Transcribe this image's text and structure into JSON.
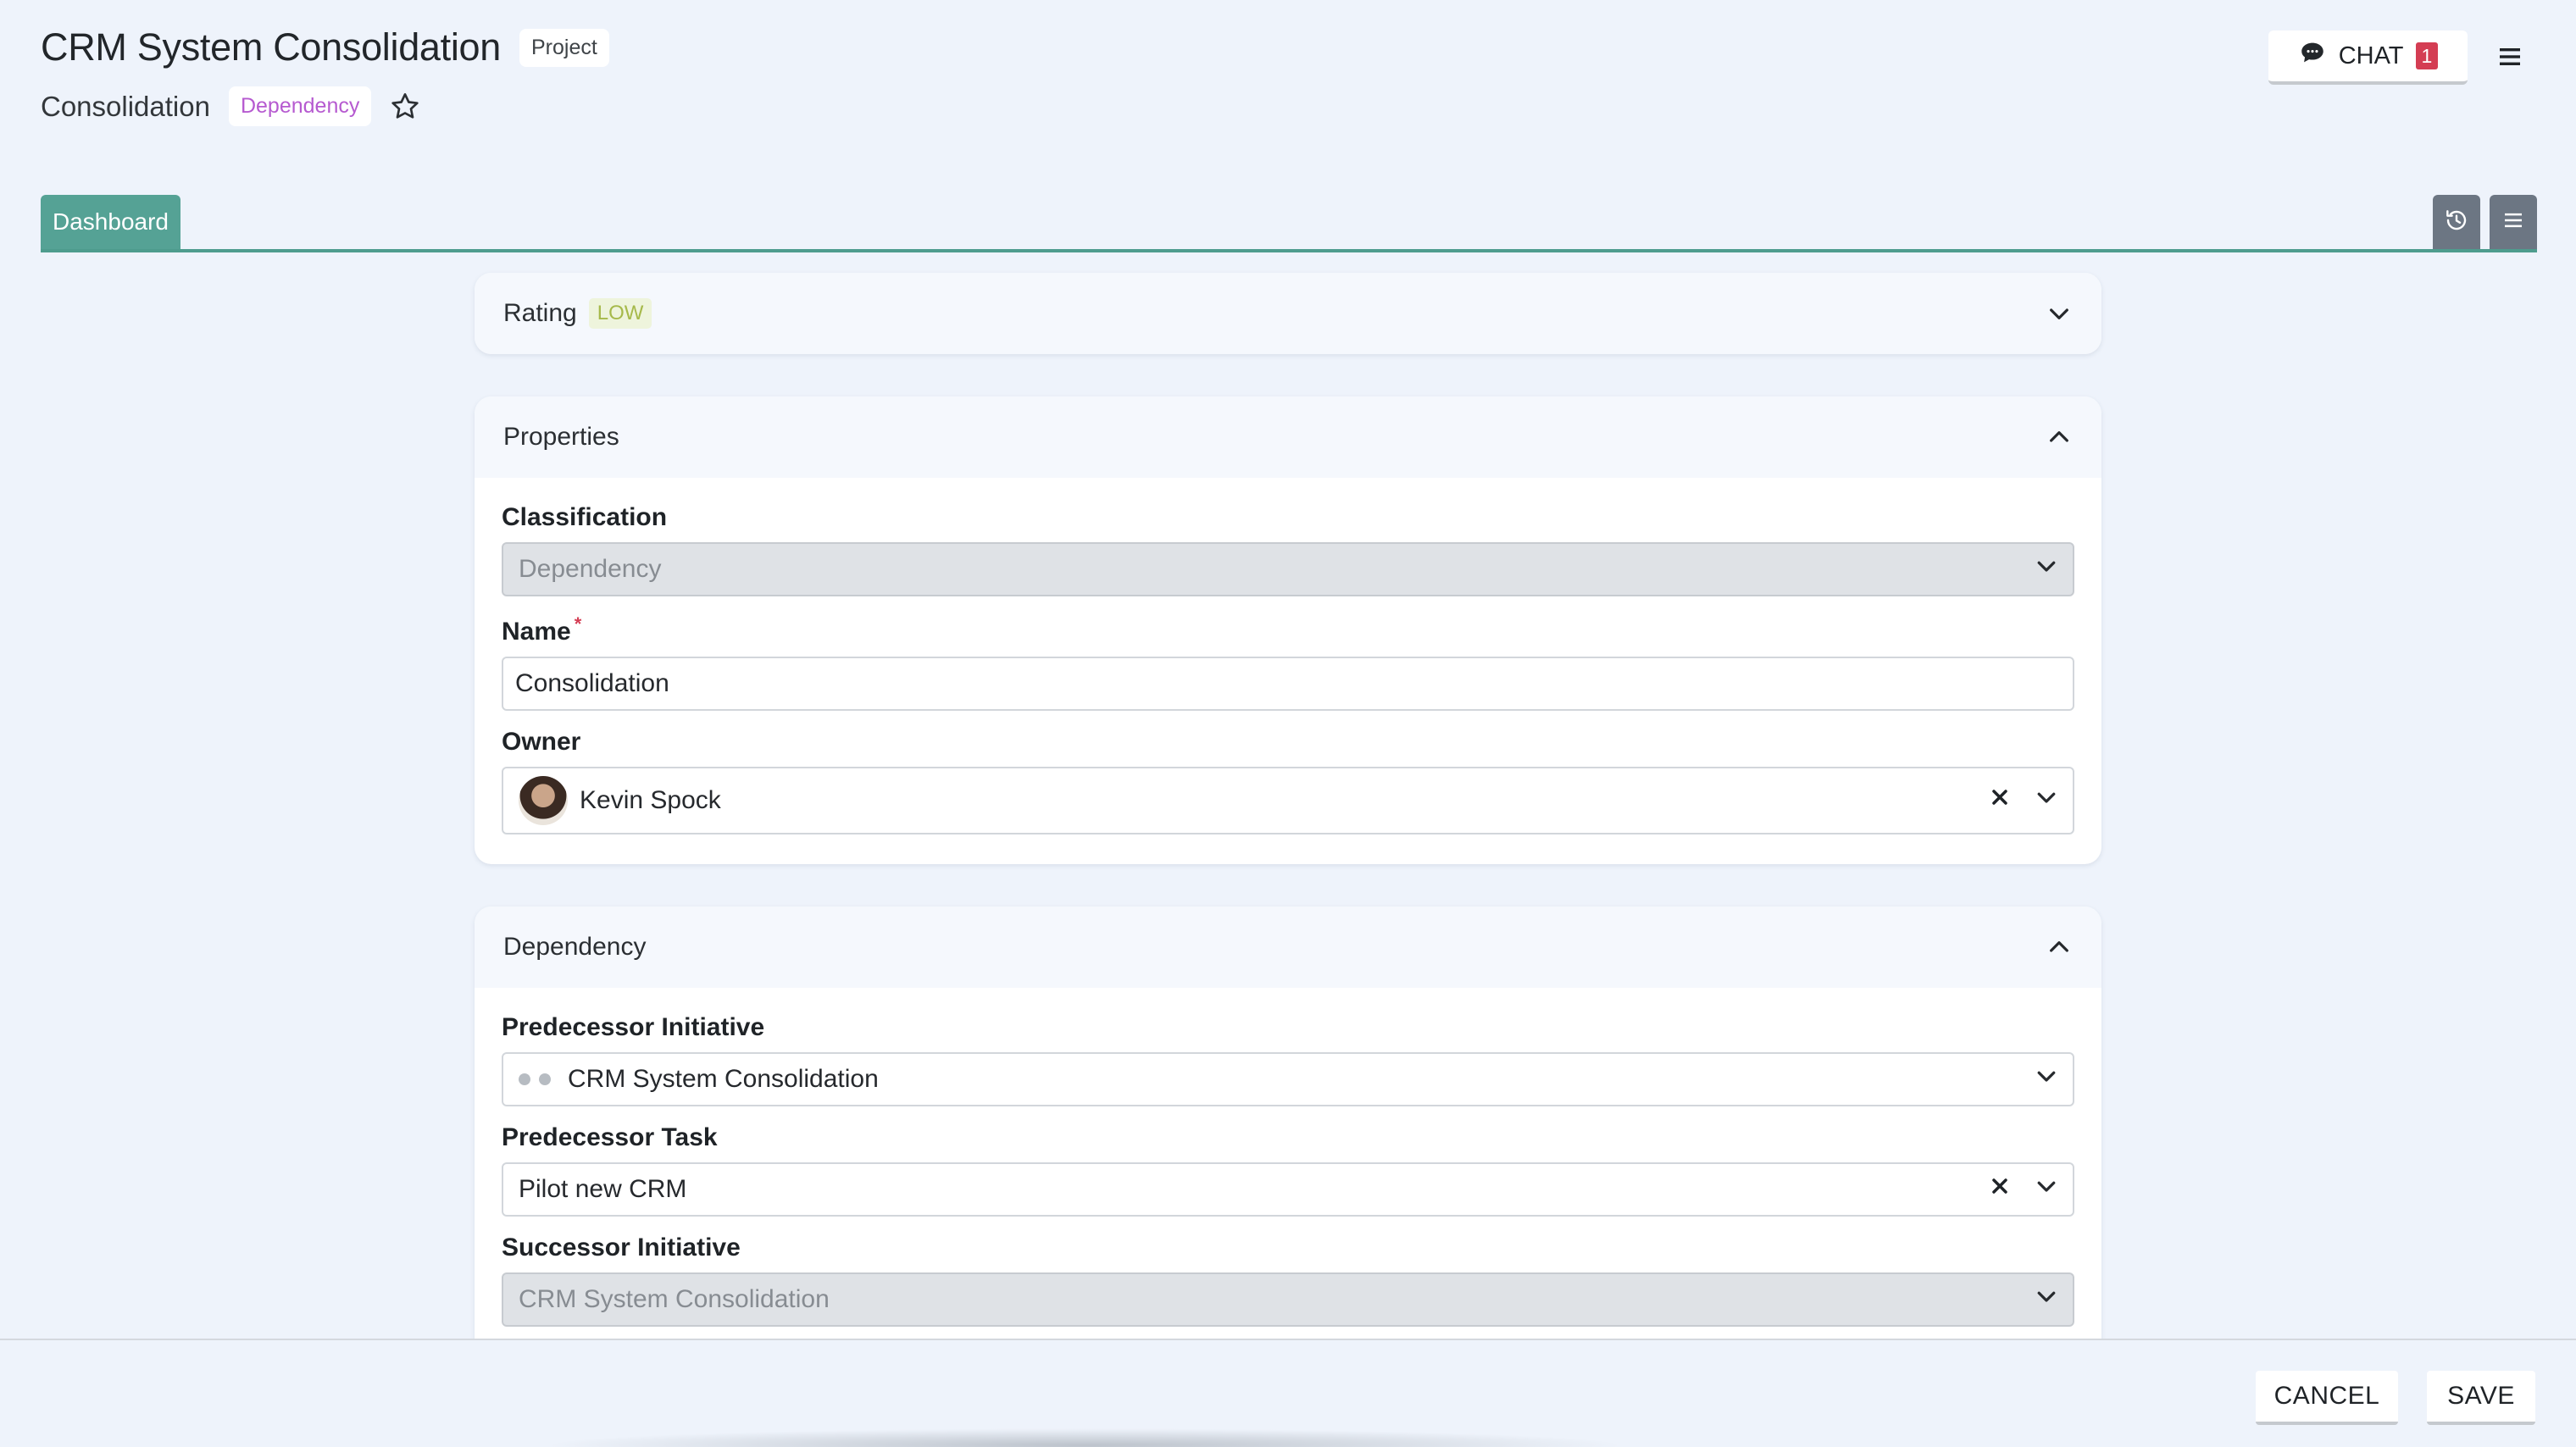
{
  "header": {
    "title": "CRM System Consolidation",
    "title_badge": "Project",
    "subtitle": "Consolidation",
    "subtitle_badge": "Dependency"
  },
  "chat": {
    "label": "CHAT",
    "count": "1"
  },
  "tabs": [
    {
      "label": "Dashboard"
    }
  ],
  "rating": {
    "title": "Rating",
    "badge": "LOW"
  },
  "properties": {
    "title": "Properties",
    "classification": {
      "label": "Classification",
      "value": "Dependency"
    },
    "name": {
      "label": "Name",
      "required_mark": "*",
      "value": "Consolidation"
    },
    "owner": {
      "label": "Owner",
      "value": "Kevin Spock"
    }
  },
  "dependency": {
    "title": "Dependency",
    "predecessor_initiative": {
      "label": "Predecessor Initiative",
      "value": "CRM System Consolidation"
    },
    "predecessor_task": {
      "label": "Predecessor Task",
      "value": "Pilot new CRM"
    },
    "successor_initiative": {
      "label": "Successor Initiative",
      "value": "CRM System Consolidation"
    }
  },
  "actions": {
    "cancel": "CANCEL",
    "save": "SAVE"
  },
  "colors": {
    "accent": "#55a295",
    "badge_dependency": "#b65ad0",
    "badge_low": "#a6b94a",
    "chat_count": "#d43d53",
    "tool_button": "#6c7683"
  },
  "icons": [
    "star-icon",
    "chat-bubble-icon",
    "hamburger-icon",
    "history-icon",
    "list-icon",
    "chevron-down-icon",
    "chevron-up-icon",
    "clear-icon"
  ]
}
